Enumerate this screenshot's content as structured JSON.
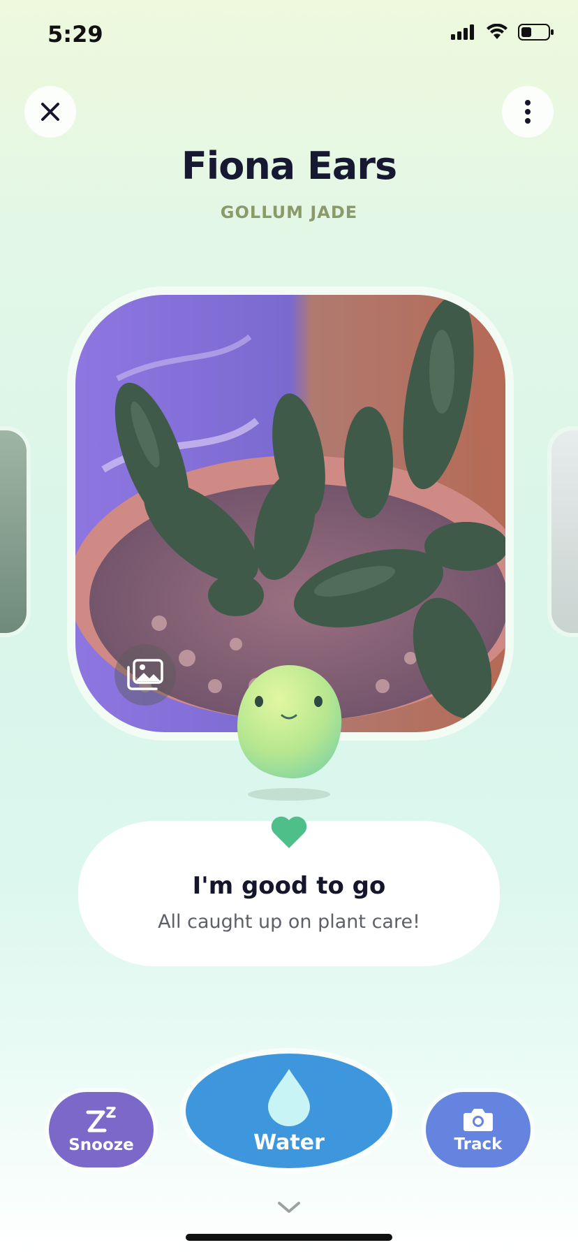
{
  "status_bar": {
    "time": "5:29"
  },
  "header": {
    "plant_name": "Fiona Ears",
    "plant_type": "GOLLUM JADE"
  },
  "status": {
    "title": "I'm good to go",
    "subtitle": "All caught up on plant care!"
  },
  "actions": {
    "snooze_label": "Snooze",
    "water_label": "Water",
    "track_label": "Track"
  },
  "colors": {
    "snooze": "#7b68c9",
    "water": "#3e96dc",
    "track": "#6584e0",
    "heart": "#4fbf8a"
  },
  "icons": [
    "close-icon",
    "more-vertical-icon",
    "gallery-icon",
    "heart-icon",
    "zzz-icon",
    "water-drop-icon",
    "camera-icon",
    "chevron-down-icon"
  ]
}
